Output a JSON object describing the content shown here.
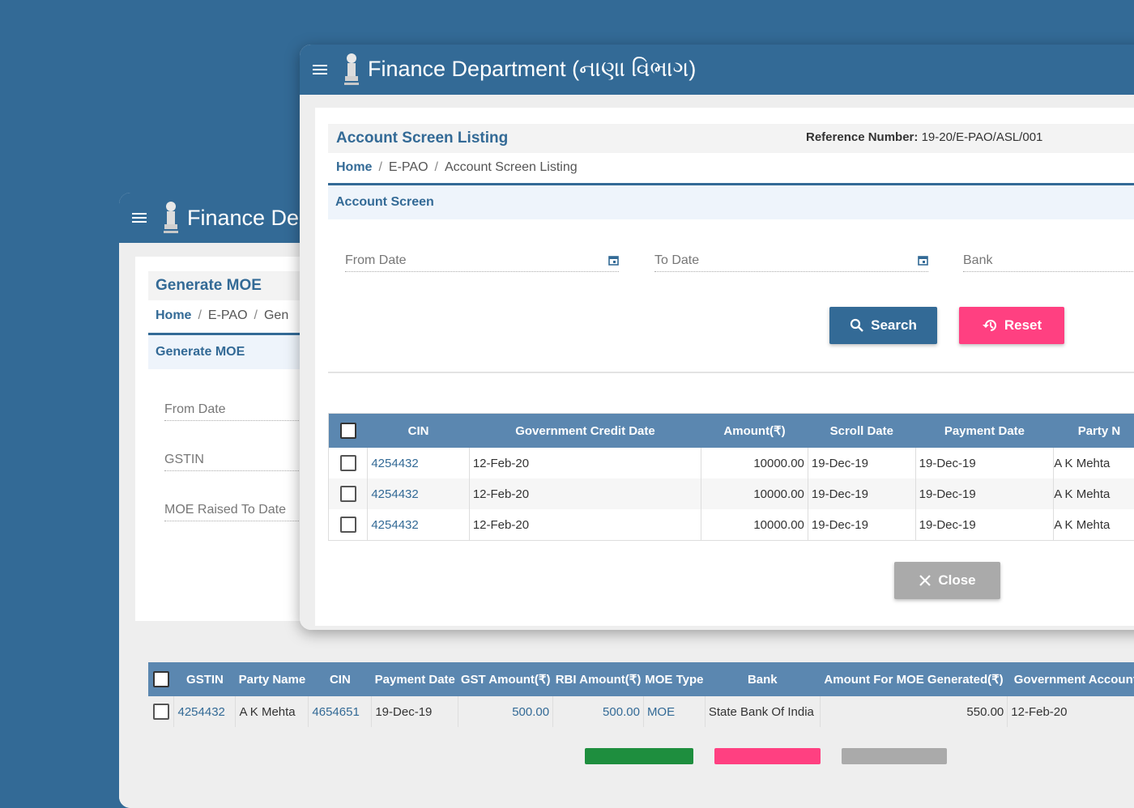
{
  "back_window": {
    "app_title": "Finance De",
    "page_title": "Generate MOE",
    "breadcrumb": {
      "home": "Home",
      "module": "E-PAO",
      "current": "Gen"
    },
    "section_title": "Generate MOE",
    "fields": {
      "from_date": "From Date",
      "gstin": "GSTIN",
      "moe_raised_to_date": "MOE Raised To Date"
    },
    "table": {
      "columns": [
        "GSTIN",
        "Party Name",
        "CIN",
        "Payment Date",
        "GST Amount(₹)",
        "RBI Amount(₹)",
        "MOE Type",
        "Bank",
        "Amount For MOE Generated(₹)",
        "Government Account"
      ],
      "rows": [
        [
          "4254432",
          "A K Mehta",
          "4654651",
          "19-Dec-19",
          "500.00",
          "500.00",
          "MOE",
          "State Bank Of India",
          "550.00",
          "12-Feb-20"
        ]
      ]
    },
    "bottom_button_colors": [
      "#1e8e3e",
      "#ff4081",
      "#aaaaaa"
    ]
  },
  "front_window": {
    "app_title": "Finance Department (નાણા વિભાગ)",
    "page_title": "Account Screen Listing",
    "reference_label": "Reference Number:",
    "reference_value": "19-20/E-PAO/ASL/001",
    "breadcrumb": {
      "home": "Home",
      "module": "E-PAO",
      "current": "Account Screen Listing"
    },
    "section_title": "Account Screen",
    "fields": {
      "from_date": "From Date",
      "to_date": "To Date",
      "bank": "Bank"
    },
    "buttons": {
      "search": "Search",
      "reset": "Reset",
      "close": "Close"
    },
    "table": {
      "columns": [
        "CIN",
        "Government Credit Date",
        "Amount(₹)",
        "Scroll Date",
        "Payment Date",
        "Party N"
      ],
      "rows": [
        [
          "4254432",
          "12-Feb-20",
          "10000.00",
          "19-Dec-19",
          "19-Dec-19",
          "A K Mehta"
        ],
        [
          "4254432",
          "12-Feb-20",
          "10000.00",
          "19-Dec-19",
          "19-Dec-19",
          "A K Mehta"
        ],
        [
          "4254432",
          "12-Feb-20",
          "10000.00",
          "19-Dec-19",
          "19-Dec-19",
          "A K Mehta"
        ]
      ]
    }
  },
  "colors": {
    "primary": "#336a96",
    "accent": "#ff4081",
    "muted": "#aaaaaa"
  },
  "icons": [
    "menu-icon",
    "emblem-icon",
    "calendar-icon",
    "search-icon",
    "history-icon",
    "close-icon",
    "checkbox-icon"
  ]
}
